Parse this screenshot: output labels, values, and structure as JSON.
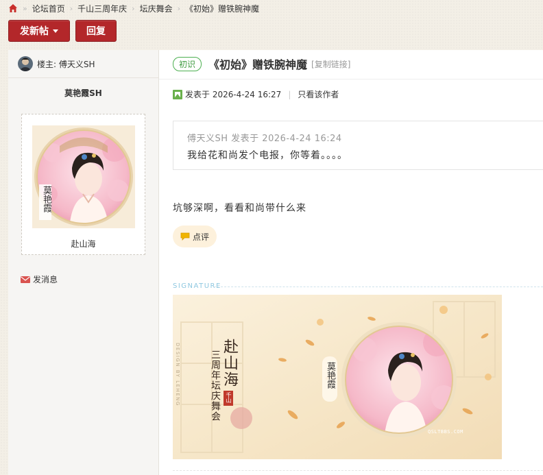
{
  "breadcrumb": {
    "items": [
      "论坛首页",
      "千山三周年庆",
      "坛庆舞会",
      "《初始》赠铁腕神魔"
    ]
  },
  "toolbar": {
    "new_post_label": "发新帖",
    "reply_label": "回复"
  },
  "author": {
    "floor_label": "楼主: 傅天义SH",
    "username": "莫艳霞SH",
    "avatar_overlay_text": "莫艳霞",
    "avatar_caption": "赴山海",
    "send_message_label": "发消息"
  },
  "post": {
    "tag": "初识",
    "title": "《初始》赠铁腕神魔",
    "copy_link_label": "[复制链接]",
    "posted_at_label": "发表于 2026-4-24 16:27",
    "only_author_label": "只看该作者",
    "quote": {
      "header": "傅天义SH 发表于 2026-4-24 16:24",
      "text": "我给花和尚发个电报，你等着。。。。"
    },
    "body": "坑够深啊，看看和尚带什么来",
    "comment_label": "点评"
  },
  "signature": {
    "label": "SIGNATURE",
    "banner_title": "赴山海",
    "banner_subtitle": "三周年坛庆舞会",
    "banner_name": "莫艳霞",
    "banner_credit": "DESIGN BY LEHENG",
    "banner_site": "QSLTBBS.COM",
    "stamp_text": "千山"
  },
  "colors": {
    "accent_red": "#b3272a",
    "tag_green": "#4caf50",
    "signature_blue": "#8fc8e0",
    "comment_bg": "#fdf1dc"
  },
  "icons": [
    "home-icon",
    "caret-down-icon",
    "calendar-icon",
    "mail-icon",
    "speech-bubble-icon"
  ]
}
